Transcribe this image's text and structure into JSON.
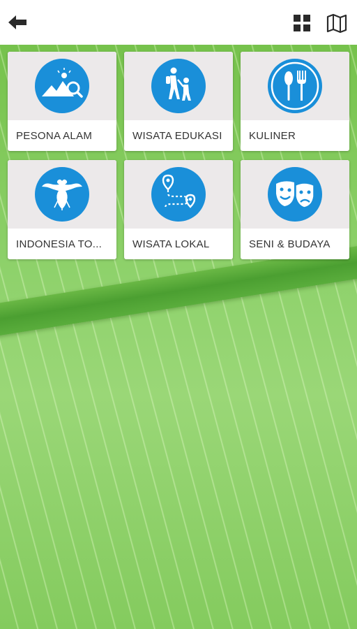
{
  "toolbar": {
    "back_icon": "arrow-left-icon",
    "grid_icon": "grid-view-icon",
    "map_icon": "map-icon"
  },
  "categories": [
    {
      "label": "PESONA ALAM",
      "icon": "nature-mountain-search-icon"
    },
    {
      "label": "WISATA EDUKASI",
      "icon": "students-walking-icon"
    },
    {
      "label": "KULINER",
      "icon": "spoon-fork-icon"
    },
    {
      "label": "INDONESIA TO...",
      "icon": "garuda-bird-icon"
    },
    {
      "label": "WISATA LOKAL",
      "icon": "route-pins-icon"
    },
    {
      "label": "SENI & BUDAYA",
      "icon": "theater-masks-icon"
    }
  ],
  "colors": {
    "icon_circle": "#1a8fd9",
    "tile_top": "#ece9ea",
    "background_leaf": "#8fd36d"
  }
}
